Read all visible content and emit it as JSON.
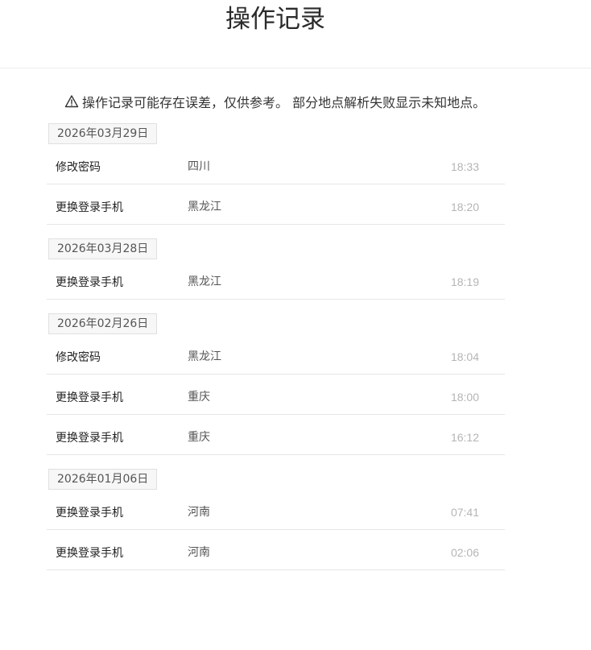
{
  "page": {
    "title": "操作记录"
  },
  "notice": {
    "icon": "warning-icon",
    "text": "操作记录可能存在误差，仅供参考。 部分地点解析失败显示未知地点。"
  },
  "groups": [
    {
      "date": "2026年03月29日",
      "records": [
        {
          "action": "修改密码",
          "location": "四川",
          "time": "18:33"
        },
        {
          "action": "更换登录手机",
          "location": "黑龙江",
          "time": "18:20"
        }
      ]
    },
    {
      "date": "2026年03月28日",
      "records": [
        {
          "action": "更换登录手机",
          "location": "黑龙江",
          "time": "18:19"
        }
      ]
    },
    {
      "date": "2026年02月26日",
      "records": [
        {
          "action": "修改密码",
          "location": "黑龙江",
          "time": "18:04"
        },
        {
          "action": "更换登录手机",
          "location": "重庆",
          "time": "18:00"
        },
        {
          "action": "更换登录手机",
          "location": "重庆",
          "time": "16:12"
        }
      ]
    },
    {
      "date": "2026年01月06日",
      "records": [
        {
          "action": "更换登录手机",
          "location": "河南",
          "time": "07:41"
        },
        {
          "action": "更换登录手机",
          "location": "河南",
          "time": "02:06"
        }
      ]
    }
  ]
}
